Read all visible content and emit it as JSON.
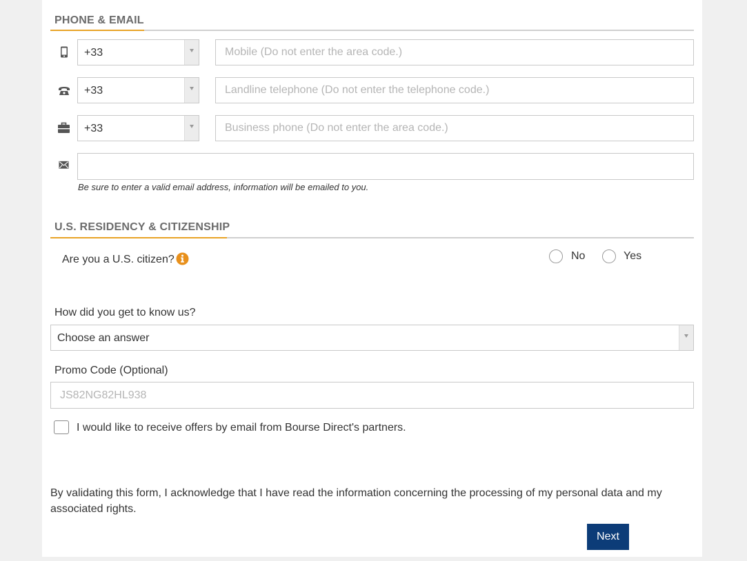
{
  "phone_email": {
    "title": "PHONE & EMAIL",
    "mobile": {
      "country_code": "+33",
      "placeholder": "Mobile (Do not enter the area code.)",
      "value": ""
    },
    "landline": {
      "country_code": "+33",
      "placeholder": "Landline telephone (Do not enter the telephone code.)",
      "value": ""
    },
    "business": {
      "country_code": "+33",
      "placeholder": "Business phone (Do not enter the area code.)",
      "value": ""
    },
    "email": {
      "value": "",
      "placeholder": ""
    },
    "email_note": "Be sure to enter a valid email address, information will be emailed to you."
  },
  "residency": {
    "title": "U.S. RESIDENCY & CITIZENSHIP",
    "citizen_question": "Are you a U.S. citizen?",
    "option_no": "No",
    "option_yes": "Yes"
  },
  "referral": {
    "label": "How did you get to know us?",
    "selected": "Choose an answer"
  },
  "promo": {
    "label": "Promo Code (Optional)",
    "placeholder": "JS82NG82HL938",
    "value": ""
  },
  "offers_checkbox_label": "I would like to receive offers by email from Bourse Direct's partners.",
  "consent_text": "By validating this form, I acknowledge that I have read the information concerning the processing of my personal data and my associated rights.",
  "next_label": "Next",
  "colors": {
    "accent": "#e8a326",
    "button": "#0c3c78",
    "info": "#e8901c"
  }
}
